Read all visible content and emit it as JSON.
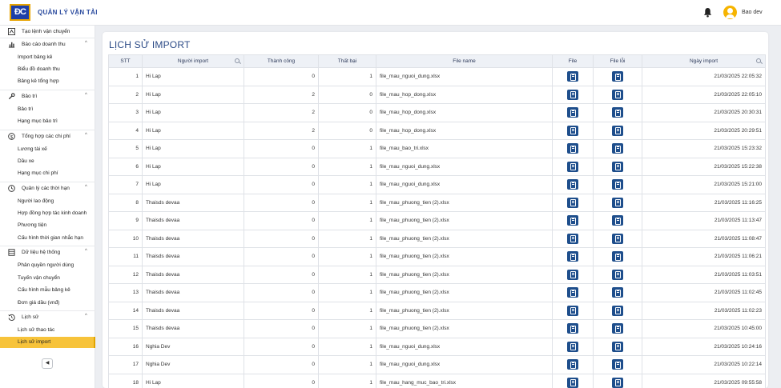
{
  "app": {
    "logo_text": "ĐC",
    "title": "QUẢN LÝ VẬN TẢI"
  },
  "user": {
    "name": "Bao dev"
  },
  "sidebar": {
    "top_item": "Tạo lệnh vận chuyển",
    "groups": [
      {
        "label": "Báo cáo doanh thu",
        "icon": "bar-chart-icon",
        "items": [
          "Import bảng kê",
          "Biểu đồ doanh thu",
          "Bảng kê tổng hợp"
        ]
      },
      {
        "label": "Bảo trì",
        "icon": "wrench-icon",
        "items": [
          "Bảo trì",
          "Hạng mục bảo trì"
        ]
      },
      {
        "label": "Tổng hợp các chi phí",
        "icon": "dollar-icon",
        "items": [
          "Lương tài xế",
          "Dầu xe",
          "Hạng mục chi phí"
        ]
      },
      {
        "label": "Quản lý các thời hạn",
        "icon": "clock-icon",
        "items": [
          "Người lao động",
          "Hợp đồng hợp tác kinh doanh",
          "Phương tiện",
          "Cấu hình thời gian nhắc hạn"
        ]
      },
      {
        "label": "Dữ liệu hệ thống",
        "icon": "database-icon",
        "items": [
          "Phân quyền người dùng",
          "Tuyến vận chuyển",
          "Cấu hình mẫu bảng kê",
          "Đơn giá dầu (vnđ)"
        ]
      },
      {
        "label": "Lịch sử",
        "icon": "history-icon",
        "items": [
          "Lịch sử thao tác",
          "Lịch sử import"
        ]
      }
    ],
    "active_item": "Lịch sử import",
    "collapse_symbol": "◀"
  },
  "page": {
    "title": "LỊCH SỬ IMPORT"
  },
  "table": {
    "headers": [
      "STT",
      "Người import",
      "Thành công",
      "Thất bại",
      "File name",
      "File",
      "File lỗi",
      "Ngày import"
    ],
    "rows": [
      [
        "1",
        "Hi Lap",
        "0",
        "1",
        "file_mau_nguoi_dung.xlsx",
        "21/03/2025 22:05:32"
      ],
      [
        "2",
        "Hi Lap",
        "2",
        "0",
        "file_mau_hop_dong.xlsx",
        "21/03/2025 22:05:10"
      ],
      [
        "3",
        "Hi Lap",
        "2",
        "0",
        "file_mau_hop_dong.xlsx",
        "21/03/2025 20:30:31"
      ],
      [
        "4",
        "Hi Lap",
        "2",
        "0",
        "file_mau_hop_dong.xlsx",
        "21/03/2025 20:29:51"
      ],
      [
        "5",
        "Hi Lap",
        "0",
        "1",
        "file_mau_bao_tri.xlsx",
        "21/03/2025 15:23:32"
      ],
      [
        "6",
        "Hi Lap",
        "0",
        "1",
        "file_mau_nguoi_dung.xlsx",
        "21/03/2025 15:22:38"
      ],
      [
        "7",
        "Hi Lap",
        "0",
        "1",
        "file_mau_nguoi_dung.xlsx",
        "21/03/2025 15:21:00"
      ],
      [
        "8",
        "Thaisds devaa",
        "0",
        "1",
        "file_mau_phuong_tien (2).xlsx",
        "21/03/2025 11:16:25"
      ],
      [
        "9",
        "Thaisds devaa",
        "0",
        "1",
        "file_mau_phuong_tien (2).xlsx",
        "21/03/2025 11:13:47"
      ],
      [
        "10",
        "Thaisds devaa",
        "0",
        "1",
        "file_mau_phuong_tien (2).xlsx",
        "21/03/2025 11:08:47"
      ],
      [
        "11",
        "Thaisds devaa",
        "0",
        "1",
        "file_mau_phuong_tien (2).xlsx",
        "21/03/2025 11:06:21"
      ],
      [
        "12",
        "Thaisds devaa",
        "0",
        "1",
        "file_mau_phuong_tien (2).xlsx",
        "21/03/2025 11:03:51"
      ],
      [
        "13",
        "Thaisds devaa",
        "0",
        "1",
        "file_mau_phuong_tien (2).xlsx",
        "21/03/2025 11:02:45"
      ],
      [
        "14",
        "Thaisds devaa",
        "0",
        "1",
        "file_mau_phuong_tien (2).xlsx",
        "21/03/2025 11:02:23"
      ],
      [
        "15",
        "Thaisds devaa",
        "0",
        "1",
        "file_mau_phuong_tien (2).xlsx",
        "21/03/2025 10:45:00"
      ],
      [
        "16",
        "Nghia Dev",
        "0",
        "1",
        "file_mau_nguoi_dung.xlsx",
        "21/03/2025 10:24:16"
      ],
      [
        "17",
        "Nghia Dev",
        "0",
        "1",
        "file_mau_nguoi_dung.xlsx",
        "21/03/2025 10:22:14"
      ],
      [
        "18",
        "Hi Lap",
        "0",
        "1",
        "file_mau_hang_muc_bao_tri.xlsx",
        "21/03/2025 09:55:58"
      ]
    ]
  },
  "colors": {
    "accent": "#f7c33a",
    "primary": "#1e4e8c",
    "title": "#2b4a86"
  }
}
